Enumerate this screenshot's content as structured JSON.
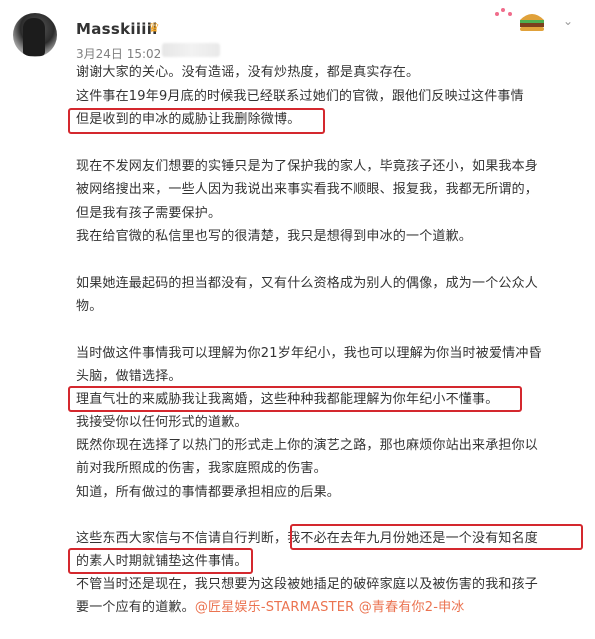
{
  "post": {
    "username": "Masskiiiii",
    "timestamp": "3月24日 15:02",
    "lines": [
      "谢谢大家的关心。没有造谣，没有炒热度，都是真实存在。",
      "这件事在19年9月底的时候我已经联系过她们的官微，跟他们反映过这件事情",
      "但是收到的申冰的威胁让我删除微博。",
      "",
      "现在不发网友们想要的实锤只是为了保护我的家人，毕竟孩子还小，如果我本身",
      "被网络搜出来，一些人因为我说出来事实看我不顺眼、报复我，我都无所谓的，",
      "但是我有孩子需要保护。",
      "我在给官微的私信里也写的很清楚，我只是想得到申冰的一个道歉。",
      "",
      "如果她连最起码的担当都没有，又有什么资格成为别人的偶像，成为一个公众人",
      "物。",
      "",
      "当时做这件事情我可以理解为你21岁年纪小，我也可以理解为你当时被爱情冲昏",
      "头脑，做错选择。",
      "理直气壮的来威胁我让我离婚，这些种种我都能理解为你年纪小不懂事。",
      "我接受你以任何形式的道歉。",
      "既然你现在选择了以热门的形式走上你的演艺之路，那也麻烦你站出来承担你以",
      "前对我所照成的伤害，我家庭照成的伤害。",
      "知道，所有做过的事情都要承担相应的后果。",
      "",
      "这些东西大家信与不信请自行判断，我不必在去年九月份她还是一个没有知名度",
      "的素人时期就铺垫这件事情。",
      "不管当时还是现在，我只想要为这段被她插足的破碎家庭以及被伤害的我和孩子",
      "要一个应有的道歉。"
    ],
    "mention_1": "@匠星娱乐-STARMASTER",
    "mention_2": "@青春有你2-申冰"
  }
}
